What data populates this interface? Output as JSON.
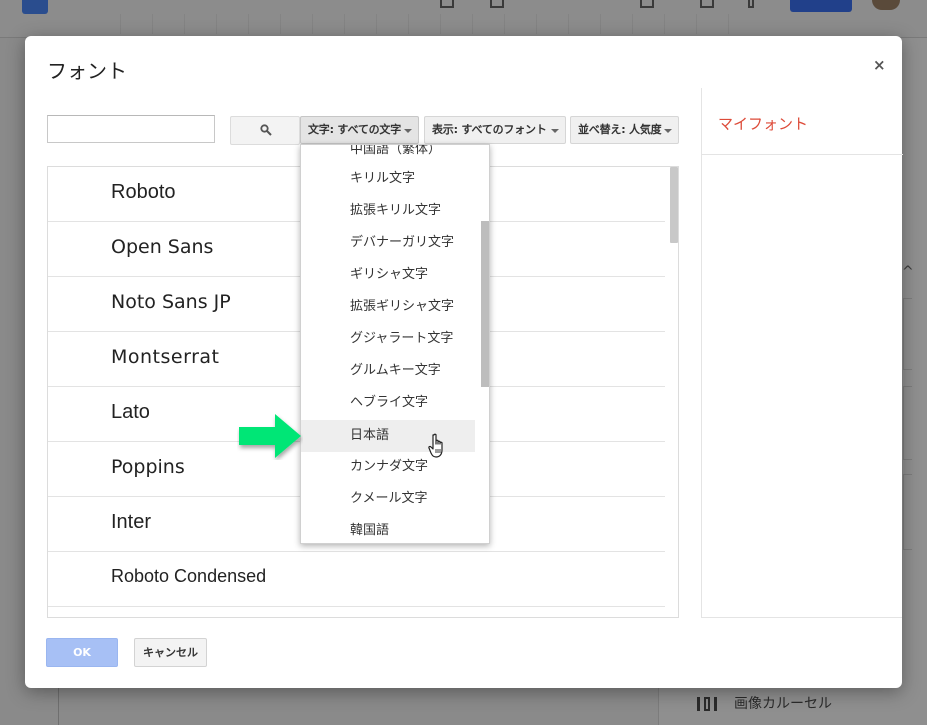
{
  "dialog": {
    "title": "フォント",
    "close_label": "×"
  },
  "toolbar": {
    "search_placeholder": "",
    "search_icon": "search-icon",
    "filters": [
      {
        "label": "文字: すべての文字"
      },
      {
        "label": "表示: すべてのフォント"
      },
      {
        "label": "並べ替え: 人気度"
      }
    ]
  },
  "fonts": [
    {
      "name": "Roboto"
    },
    {
      "name": "Open Sans"
    },
    {
      "name": "Noto Sans JP"
    },
    {
      "name": "Montserrat"
    },
    {
      "name": "Lato"
    },
    {
      "name": "Poppins"
    },
    {
      "name": "Inter"
    },
    {
      "name": "Roboto Condensed"
    }
  ],
  "script_menu": {
    "items": [
      {
        "label": "中国語（繁体）"
      },
      {
        "label": "キリル文字"
      },
      {
        "label": "拡張キリル文字"
      },
      {
        "label": "デバナーガリ文字"
      },
      {
        "label": "ギリシャ文字"
      },
      {
        "label": "拡張ギリシャ文字"
      },
      {
        "label": "グジャラート文字"
      },
      {
        "label": "グルムキー文字"
      },
      {
        "label": "ヘブライ文字"
      },
      {
        "label": "日本語"
      },
      {
        "label": "カンナダ文字"
      },
      {
        "label": "クメール文字"
      },
      {
        "label": "韓国語"
      }
    ],
    "highlighted": "日本語"
  },
  "my_fonts": {
    "title": "マイフォント"
  },
  "buttons": {
    "ok": "OK",
    "cancel": "キャンセル"
  },
  "background": {
    "carousel_label": "画像カルーセル"
  },
  "colors": {
    "accent_red": "#dd4b39",
    "ok_blue": "#a7c0f5",
    "arrow_green": "#00e676"
  }
}
